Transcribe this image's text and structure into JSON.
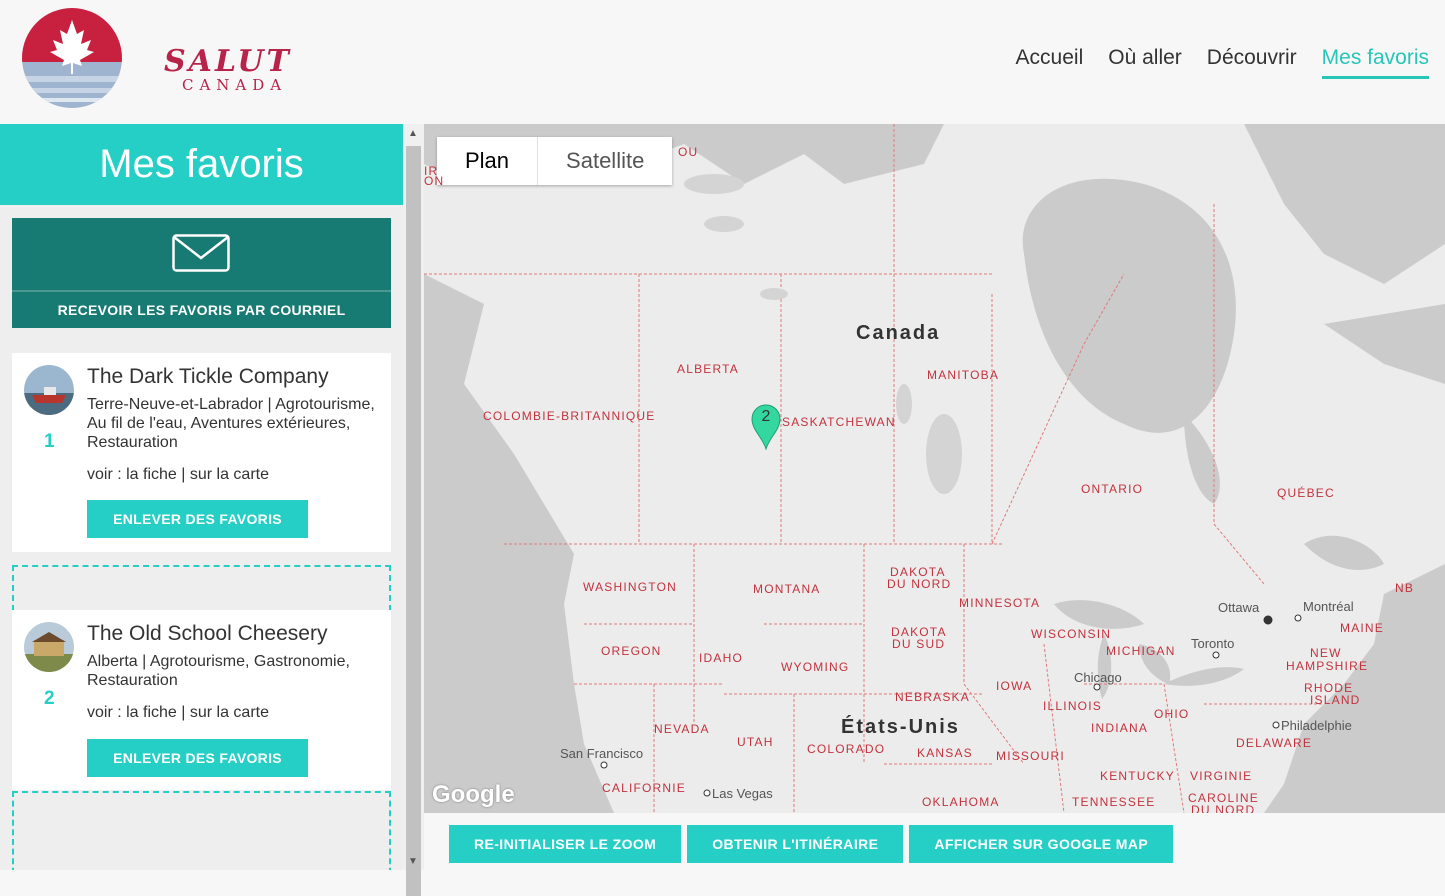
{
  "brand": {
    "name_line1": "SALUT",
    "name_line2": "CANADA"
  },
  "nav": [
    {
      "label": "Accueil",
      "active": false
    },
    {
      "label": "Où aller",
      "active": false
    },
    {
      "label": "Découvrir",
      "active": false
    },
    {
      "label": "Mes favoris",
      "active": true
    }
  ],
  "sidebar": {
    "title": "Mes favoris",
    "email_label": "RECEVOIR LES FAVORIS PAR COURRIEL",
    "favorites": [
      {
        "number": "1",
        "name": "The Dark Tickle Company",
        "meta": "Terre-Neuve-et-Labrador | Agrotourisme, Au fil de l'eau, Aventures extérieures, Restauration",
        "links": "voir : la fiche | sur la carte",
        "remove_label": "ENLEVER DES FAVORIS"
      },
      {
        "number": "2",
        "name": "The Old School Cheesery",
        "meta": "Alberta | Agrotourisme, Gastronomie, Restauration",
        "links": "voir : la fiche | sur la carte",
        "remove_label": "ENLEVER DES FAVORIS"
      }
    ]
  },
  "map": {
    "toggle": {
      "plan": "Plan",
      "satellite": "Satellite",
      "selected": "Plan"
    },
    "pin_label": "2",
    "countries": [
      "Canada",
      "États-Unis"
    ],
    "regions": [
      "COLOMBIE-BRITANNIQUE",
      "ALBERTA",
      "SASKATCHEWAN",
      "MANITOBA",
      "ONTARIO",
      "QUÉBEC",
      "NB",
      "WASHINGTON",
      "MONTANA",
      "DAKOTA",
      "DU NORD",
      "MINNESOTA",
      "OREGON",
      "IDAHO",
      "WYOMING",
      "DAKOTA",
      "DU SUD",
      "WISCONSIN",
      "MICHIGAN",
      "NEW",
      "HAMPSHIRE",
      "MAINE",
      "RHODE",
      "ISLAND",
      "NEBRASKA",
      "IOWA",
      "ILLINOIS",
      "INDIANA",
      "OHIO",
      "NEVADA",
      "UTAH",
      "COLORADO",
      "KANSAS",
      "MISSOURI",
      "KENTUCKY",
      "VIRGINIE",
      "DELAWARE",
      "CALIFORNIE",
      "OKLAHOMA",
      "TENNESSEE",
      "CAROLINE",
      "DU NORD",
      "OU",
      "IR",
      "ON"
    ],
    "cities": [
      "Ottawa",
      "Montréal",
      "Toronto",
      "Chicago",
      "Philadelphie",
      "San Francisco",
      "Las Vegas"
    ],
    "logo": "Google"
  },
  "actions": {
    "reset_zoom": "RE-INITIALISER LE ZOOM",
    "itinerary": "OBTENIR L'ITINÉRAIRE",
    "google_map": "AFFICHER SUR GOOGLE MAP"
  },
  "colors": {
    "accent": "#26cfc6",
    "dark_teal": "#177a73",
    "brand_red": "#b8234a",
    "map_label": "#c2333e"
  }
}
